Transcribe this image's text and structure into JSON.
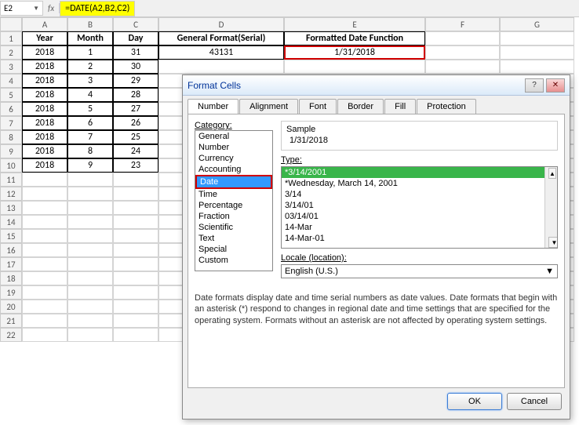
{
  "formula": {
    "cellref": "E2",
    "fx": "fx",
    "value": "=DATE(A2,B2,C2)"
  },
  "cols": [
    "A",
    "B",
    "C",
    "D",
    "E",
    "F",
    "G"
  ],
  "headers": {
    "A": "Year",
    "B": "Month",
    "C": "Day",
    "D": "General Format(Serial)",
    "E": "Formatted Date Function"
  },
  "rows": [
    {
      "n": "1"
    },
    {
      "n": "2",
      "A": "2018",
      "B": "1",
      "C": "31",
      "D": "43131",
      "E": "1/31/2018"
    },
    {
      "n": "3",
      "A": "2018",
      "B": "2",
      "C": "30"
    },
    {
      "n": "4",
      "A": "2018",
      "B": "3",
      "C": "29"
    },
    {
      "n": "5",
      "A": "2018",
      "B": "4",
      "C": "28"
    },
    {
      "n": "6",
      "A": "2018",
      "B": "5",
      "C": "27"
    },
    {
      "n": "7",
      "A": "2018",
      "B": "6",
      "C": "26"
    },
    {
      "n": "8",
      "A": "2018",
      "B": "7",
      "C": "25"
    },
    {
      "n": "9",
      "A": "2018",
      "B": "8",
      "C": "24"
    },
    {
      "n": "10",
      "A": "2018",
      "B": "9",
      "C": "23"
    },
    {
      "n": "11"
    },
    {
      "n": "12"
    },
    {
      "n": "13"
    },
    {
      "n": "14"
    },
    {
      "n": "15"
    },
    {
      "n": "16"
    },
    {
      "n": "17"
    },
    {
      "n": "18"
    },
    {
      "n": "19"
    },
    {
      "n": "20"
    },
    {
      "n": "21"
    },
    {
      "n": "22"
    }
  ],
  "dialog": {
    "title": "Format Cells",
    "help": "?",
    "close": "✕",
    "tabs": [
      "Number",
      "Alignment",
      "Font",
      "Border",
      "Fill",
      "Protection"
    ],
    "category_label": "Category:",
    "categories": [
      "General",
      "Number",
      "Currency",
      "Accounting",
      "Date",
      "Time",
      "Percentage",
      "Fraction",
      "Scientific",
      "Text",
      "Special",
      "Custom"
    ],
    "sample_label": "Sample",
    "sample_value": "1/31/2018",
    "type_label": "Type:",
    "types": [
      "*3/14/2001",
      "*Wednesday, March 14, 2001",
      "3/14",
      "3/14/01",
      "03/14/01",
      "14-Mar",
      "14-Mar-01"
    ],
    "locale_label": "Locale (location):",
    "locale_value": "English (U.S.)",
    "description": "Date formats display date and time serial numbers as date values.  Date formats that begin with an asterisk (*) respond to changes in regional date and time settings that are specified for the operating system. Formats without an asterisk are not affected by operating system settings.",
    "ok": "OK",
    "cancel": "Cancel"
  }
}
